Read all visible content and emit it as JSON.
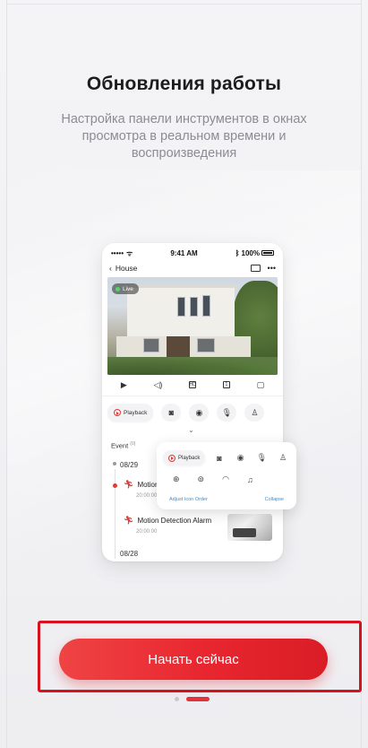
{
  "onboarding": {
    "title": "Обновления работы",
    "subtitle": "Настройка панели инструментов в окнах просмотра в реальном времени и воспроизведения",
    "cta_label": "Начать сейчас",
    "page_index": 2,
    "page_count": 2
  },
  "phone": {
    "status": {
      "carrier": "••••• ",
      "time": "9:41 AM",
      "battery": "100%"
    },
    "nav": {
      "back_label": "House",
      "more": "•••"
    },
    "live_label": "Live",
    "controls": [
      "▶",
      "◁)",
      "HD",
      "1",
      "▢"
    ],
    "action_bar": {
      "playback_label": "Playback"
    },
    "events": {
      "label": "Event",
      "count": "(0)",
      "date1": "08/29",
      "item1_title": "Motion",
      "item1_time": "20:00:00",
      "item2_title": "Motion Detection Alarm",
      "item2_time": "20:00:00",
      "date2": "08/28"
    }
  },
  "panel": {
    "playback_label": "Playback",
    "adjust_label": "Adjust Icon Order",
    "collapse_label": "Collapse"
  },
  "colors": {
    "accent": "#e8262f",
    "highlight_border": "#d6121e",
    "link": "#3a8fd6"
  }
}
